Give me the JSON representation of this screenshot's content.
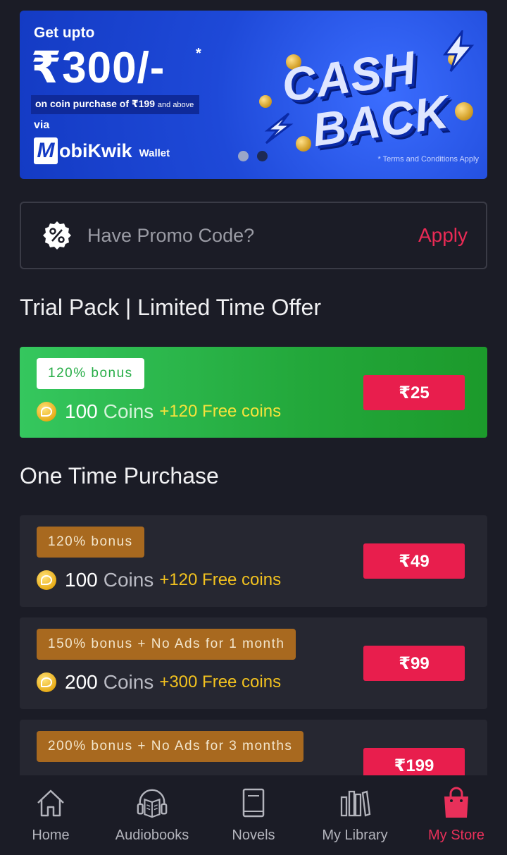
{
  "banner": {
    "get_upto": "Get upto",
    "amount": "₹300/-",
    "star": "*",
    "strip_main": "on coin purchase of ₹199",
    "strip_small": "and above",
    "via": "via",
    "brand_letter": "M",
    "brand_name": "obiKwik",
    "wallet": "Wallet",
    "cash": "CASH",
    "back": "BACK",
    "terms": "* Terms and Conditions Apply"
  },
  "promo": {
    "placeholder": "Have Promo Code?",
    "apply": "Apply"
  },
  "trial": {
    "title": "Trial Pack | Limited Time Offer",
    "badge": "120% bonus",
    "coins": "100",
    "coins_word": "Coins",
    "free": "+120 Free coins",
    "price": "₹25"
  },
  "one_time": {
    "title": "One Time Purchase",
    "packs": [
      {
        "badge": "120% bonus",
        "coins": "100",
        "coins_word": "Coins",
        "free": "+120 Free coins",
        "price": "₹49"
      },
      {
        "badge": "150% bonus + No Ads for 1 month",
        "coins": "200",
        "coins_word": "Coins",
        "free": "+300 Free coins",
        "price": "₹99"
      },
      {
        "badge": "200% bonus + No Ads for 3 months",
        "price": "₹199"
      }
    ]
  },
  "nav": {
    "items": [
      {
        "label": "Home",
        "icon": "home-icon"
      },
      {
        "label": "Audiobooks",
        "icon": "audiobook-icon"
      },
      {
        "label": "Novels",
        "icon": "book-icon"
      },
      {
        "label": "My Library",
        "icon": "library-icon"
      },
      {
        "label": "My Store",
        "icon": "shopping-bag-icon",
        "active": true
      }
    ]
  },
  "colors": {
    "accent": "#e81e4d",
    "trial_green": "#23a83b",
    "badge_brown": "#a8691f",
    "background": "#1b1c26"
  }
}
